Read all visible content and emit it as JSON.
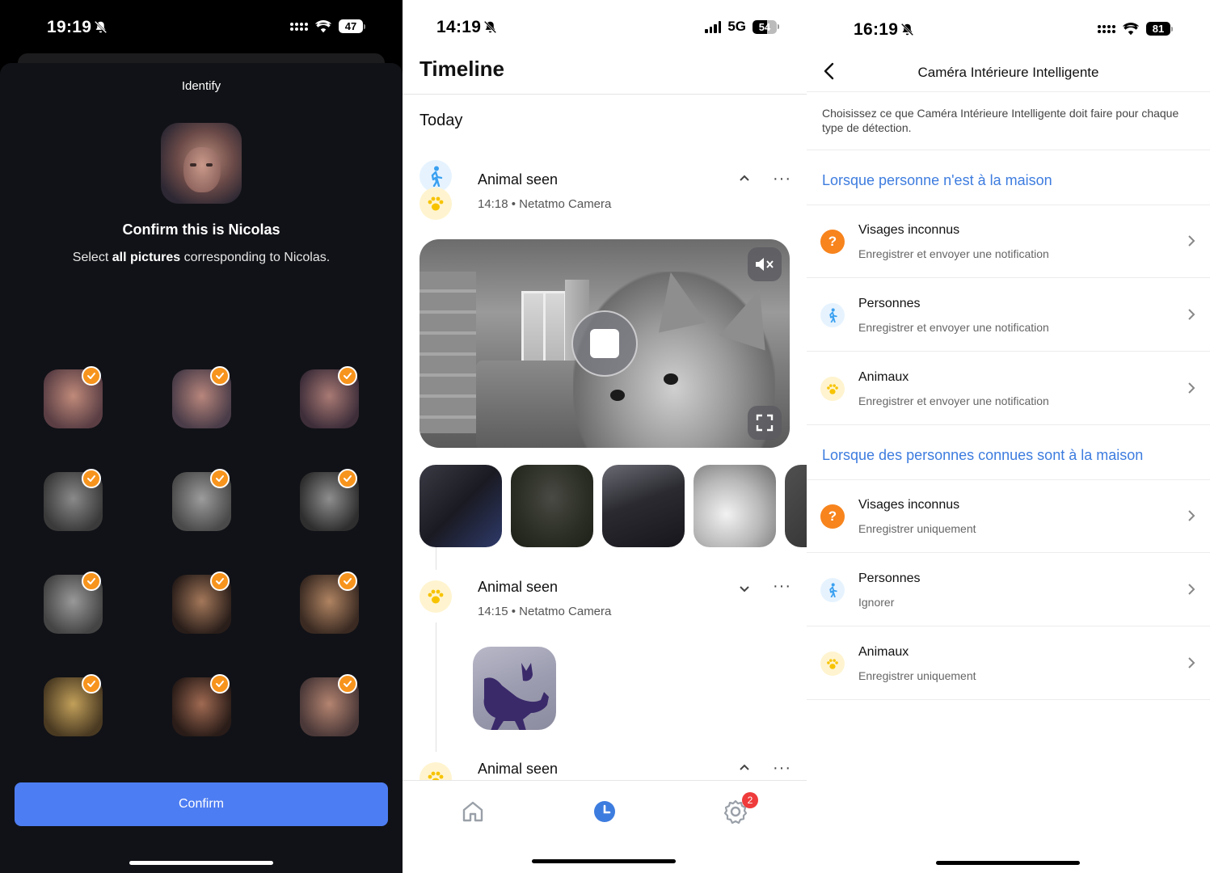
{
  "panel1": {
    "status": {
      "time": "19:19",
      "battery": "47"
    },
    "sheet_title": "Identify",
    "confirm_title": "Confirm this is Nicolas",
    "confirm_sub_prefix": "Select ",
    "confirm_sub_bold": "all pictures",
    "confirm_sub_suffix": " corresponding to Nicolas.",
    "confirm_button": "Confirm",
    "faces_selected": 15,
    "accent": "#f7941d",
    "button_color": "#4d7df2"
  },
  "panel2": {
    "status": {
      "time": "14:19",
      "network": "5G",
      "battery": "54"
    },
    "header": "Timeline",
    "section": "Today",
    "events": [
      {
        "title": "Animal seen",
        "time": "14:18",
        "camera": "Netatmo Camera",
        "expanded": true
      },
      {
        "title": "Animal seen",
        "time": "14:15",
        "camera": "Netatmo Camera",
        "expanded": false
      },
      {
        "title": "Animal seen",
        "expanded": true
      }
    ],
    "meta_separator": "•",
    "more_glyph": "···",
    "tabs": [
      {
        "name": "home-tab",
        "icon": "home-icon",
        "active": false
      },
      {
        "name": "timeline-tab",
        "icon": "clock-icon",
        "active": true
      },
      {
        "name": "settings-tab",
        "icon": "gear-icon",
        "active": false,
        "badge": "2"
      }
    ],
    "accent": "#3d7cdf"
  },
  "panel3": {
    "status": {
      "time": "16:19",
      "battery": "81"
    },
    "title": "Caméra Intérieure Intelligente",
    "intro": "Choisissez ce que Caméra Intérieure Intelligente doit faire pour chaque type de détection.",
    "sections": [
      {
        "title": "Lorsque personne n'est à la maison",
        "rows": [
          {
            "icon": "unknown-face-icon",
            "title": "Visages inconnus",
            "sub": "Enregistrer et envoyer une notification"
          },
          {
            "icon": "person-icon",
            "title": "Personnes",
            "sub": "Enregistrer et envoyer une notification"
          },
          {
            "icon": "paw-icon",
            "title": "Animaux",
            "sub": "Enregistrer et envoyer une notification"
          }
        ]
      },
      {
        "title": "Lorsque des personnes connues sont à la maison",
        "rows": [
          {
            "icon": "unknown-face-icon",
            "title": "Visages inconnus",
            "sub": "Enregistrer uniquement"
          },
          {
            "icon": "person-icon",
            "title": "Personnes",
            "sub": "Ignorer"
          },
          {
            "icon": "paw-icon",
            "title": "Animaux",
            "sub": "Enregistrer uniquement"
          }
        ]
      }
    ],
    "section_color": "#3d7cdf",
    "warning_color": "#f7841d"
  }
}
